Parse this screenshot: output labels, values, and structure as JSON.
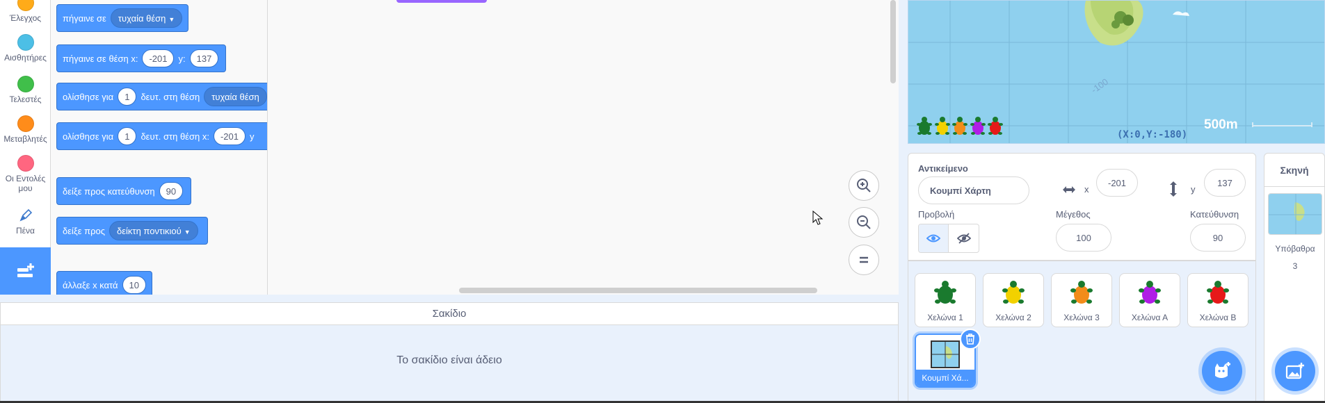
{
  "categories": [
    {
      "label": "Έλεγχος",
      "color": "#ffab19"
    },
    {
      "label": "Αισθητήρες",
      "color": "#4cbfe6"
    },
    {
      "label": "Τελεστές",
      "color": "#40bf4a"
    },
    {
      "label": "Μεταβλητές",
      "color": "#ff8c1a"
    },
    {
      "label": "Οι Εντολές μου",
      "color": "#ff6680"
    },
    {
      "label": "Πένα",
      "icon": "pen-icon"
    }
  ],
  "blocks": {
    "goto_random": {
      "text": "πήγαινε σε",
      "dropdown": "τυχαία θέση"
    },
    "goto_xy": {
      "text": "πήγαινε σε θέση x:",
      "x": "-201",
      "y_label": "y:",
      "y": "137"
    },
    "glide_random": {
      "text": "ολίσθησε για",
      "secs": "1",
      "text2": "δευτ. στη θέση",
      "dropdown": "τυχαία θέση"
    },
    "glide_xy": {
      "text": "ολίσθησε για",
      "secs": "1",
      "text2": "δευτ. στη θέση x:",
      "x": "-201",
      "y_label": "y"
    },
    "point_dir": {
      "text": "δείξε προς κατεύθυνση",
      "value": "90"
    },
    "point_towards": {
      "text": "δείξε προς",
      "dropdown": "δείκτη ποντικιού"
    },
    "change_x": {
      "text": "άλλαξε x κατά",
      "value": "10"
    }
  },
  "zoom": {
    "in": "+",
    "out": "−",
    "reset": "="
  },
  "backpack": {
    "title": "Σακίδιο",
    "empty": "Το σακίδιο είναι άδειο"
  },
  "stage": {
    "scale_label": "500m",
    "coord_label": "(X:0,Y:-180)",
    "map_tick": "-100",
    "turtle_colors": [
      "#1a7a2e",
      "#f2d100",
      "#f28c1a",
      "#b01ee6",
      "#e61919"
    ]
  },
  "sprite_info": {
    "sprite_label": "Αντικείμενο",
    "sprite_name": "Κουμπί Χάρτη",
    "x_label": "x",
    "x_value": "-201",
    "y_label": "y",
    "y_value": "137",
    "show_label": "Προβολή",
    "size_label": "Μέγεθος",
    "size_value": "100",
    "direction_label": "Κατεύθυνση",
    "direction_value": "90"
  },
  "sprites": [
    {
      "name": "Χελώνα 1",
      "color": "#1a7a2e"
    },
    {
      "name": "Χελώνα 2",
      "color": "#f2d100"
    },
    {
      "name": "Χελώνα 3",
      "color": "#f28c1a"
    },
    {
      "name": "Χελώνα Α",
      "color": "#b01ee6"
    },
    {
      "name": "Χελώνα Β",
      "color": "#e61919"
    },
    {
      "name": "Κουμπί Χά...",
      "selected": true
    }
  ],
  "stage_panel": {
    "title": "Σκηνή",
    "backdrops_label": "Υπόβαθρα",
    "backdrops_count": "3"
  }
}
